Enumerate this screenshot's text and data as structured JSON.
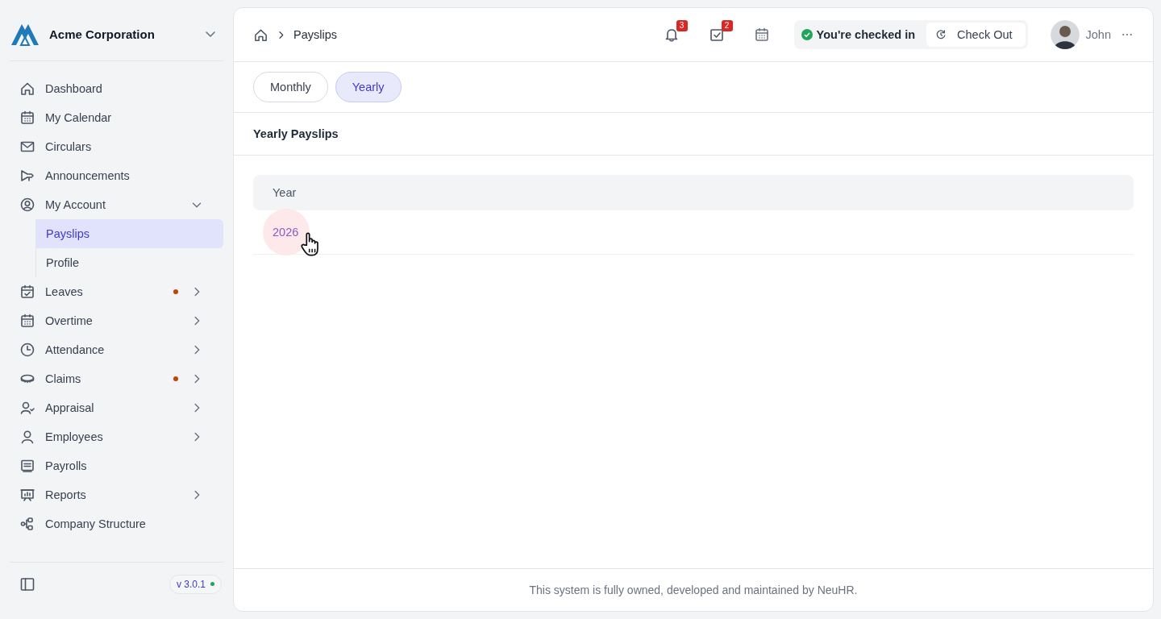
{
  "sidebar": {
    "company": "Acme Corporation",
    "items": [
      {
        "label": "Dashboard",
        "selected": false,
        "dot": false
      },
      {
        "label": "My Calendar",
        "selected": false,
        "dot": false
      },
      {
        "label": "Circulars",
        "selected": false,
        "dot": false
      },
      {
        "label": "Announcements",
        "selected": false,
        "dot": false
      },
      {
        "label": "My Account",
        "selected": false,
        "dot": false,
        "expanded": true,
        "children": [
          {
            "label": "Payslips",
            "selected": true
          },
          {
            "label": "Profile",
            "selected": false
          }
        ]
      },
      {
        "label": "Leaves",
        "selected": false,
        "dot": true,
        "expanded": false
      },
      {
        "label": "Overtime",
        "selected": false,
        "dot": false,
        "expanded": false
      },
      {
        "label": "Attendance",
        "selected": false,
        "dot": false,
        "expanded": false
      },
      {
        "label": "Claims",
        "selected": false,
        "dot": true,
        "expanded": false
      },
      {
        "label": "Appraisal",
        "selected": false,
        "dot": false,
        "expanded": false
      },
      {
        "label": "Employees",
        "selected": false,
        "dot": false,
        "expanded": false
      },
      {
        "label": "Payrolls",
        "selected": false,
        "dot": false
      },
      {
        "label": "Reports",
        "selected": false,
        "dot": false,
        "expanded": false
      },
      {
        "label": "Company Structure",
        "selected": false,
        "dot": false
      }
    ],
    "version": "v 3.0.1"
  },
  "header": {
    "breadcrumb": [
      "Payslips"
    ],
    "notifications_badge": "3",
    "tasks_badge": "2",
    "check_status": "You're checked in",
    "check_button": "Check Out",
    "user": "John"
  },
  "tabs": [
    {
      "label": "Monthly",
      "selected": false
    },
    {
      "label": "Yearly",
      "selected": true
    }
  ],
  "section_title": "Yearly Payslips",
  "table": {
    "columns": [
      "Year"
    ],
    "rows": [
      [
        "2026"
      ]
    ]
  },
  "footer": "This system is fully owned, developed and maintained by NeuHR."
}
